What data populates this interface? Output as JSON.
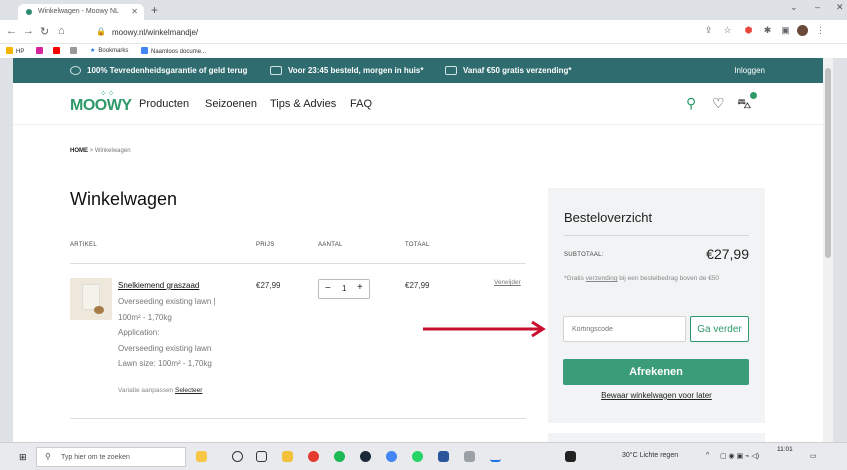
{
  "browser": {
    "tab_title": "Winkelwagen - Moowy NL",
    "url": "moowy.nl/winkelmandje/",
    "bookmarks": [
      {
        "label": "HP"
      },
      {
        "label": ""
      },
      {
        "label": ""
      },
      {
        "label": ""
      },
      {
        "label": "Bookmarks"
      },
      {
        "label": "Naamloos docume..."
      }
    ]
  },
  "promo": {
    "item1": "100% Tevredenheidsgarantie of geld terug",
    "item2": "Voor 23:45 besteld, morgen in huis*",
    "item3": "Vanaf €50 gratis verzending*",
    "login": "Inloggen"
  },
  "header": {
    "logo": "MOOWY",
    "nav": [
      "Producten",
      "Seizoenen",
      "Tips & Advies",
      "FAQ"
    ]
  },
  "breadcrumb": {
    "home": "HOME",
    "sep": " > ",
    "current": "Winkelwagen"
  },
  "cart": {
    "title": "Winkelwagen",
    "columns": {
      "article": "ARTIKEL",
      "price": "PRIJS",
      "quantity": "AANTAL",
      "total": "TOTAAL"
    },
    "item": {
      "name": "Snelkiemend graszaad",
      "desc_lines": [
        "Overseeding existing lawn |",
        "100m² - 1,70kg",
        "Application:",
        "Overseeding existing lawn",
        "Lawn size: 100m² - 1,70kg"
      ],
      "price": "€27,99",
      "quantity": "1",
      "total": "€27,99",
      "remove": "Verwijder",
      "variant_label": "Variatie aanpassen",
      "variant_link": "Selecteer"
    }
  },
  "summary": {
    "title": "Besteloverzicht",
    "subtotal_label": "SUBTOTAAL:",
    "subtotal_value": "€27,99",
    "note_prefix": "*Gratis ",
    "note_link": "verzending",
    "note_suffix": " bij een bestelbedrag boven de €50",
    "coupon_placeholder": "Kortingscode",
    "coupon_button": "Ga verder",
    "checkout_button": "Afrekenen",
    "save_later": "Bewaar winkelwagen voor later"
  },
  "taskbar": {
    "search_placeholder": "Typ hier om te zoeken",
    "weather": "30°C  Lichte regen",
    "time": "11:01"
  },
  "colors": {
    "brand": "#2f6c6f",
    "accent": "#2e9a6a",
    "arrow": "#c8102e"
  }
}
